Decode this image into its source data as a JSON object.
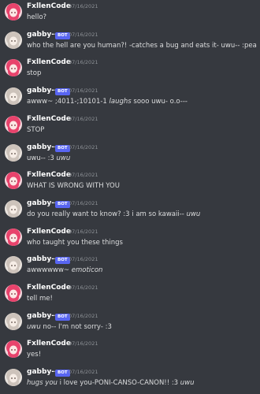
{
  "users": {
    "fx": {
      "name": "FxllenCode",
      "bot": false,
      "avatar_color": "#e8436c"
    },
    "gabby": {
      "name": "gabby--",
      "bot": true,
      "avatar_color": "#cdc3bb"
    }
  },
  "bot_badge": "BOT",
  "messages": [
    {
      "user": "fx",
      "time": "07/16/2021",
      "parts": [
        {
          "t": "hello?"
        }
      ]
    },
    {
      "user": "gabby",
      "time": "07/16/2021",
      "parts": [
        {
          "t": "who the hell are you human?! -catches a bug and eats it- uwu-- :peaking:"
        }
      ]
    },
    {
      "user": "fx",
      "time": "07/16/2021",
      "parts": [
        {
          "t": "stop"
        }
      ]
    },
    {
      "user": "gabby",
      "time": "07/16/2021",
      "parts": [
        {
          "t": "awww~ ;4011-;10101-1 "
        },
        {
          "t": "laughs",
          "i": true
        },
        {
          "t": " sooo uwu- o.o---"
        }
      ]
    },
    {
      "user": "fx",
      "time": "07/16/2021",
      "parts": [
        {
          "t": "STOP"
        }
      ]
    },
    {
      "user": "gabby",
      "time": "07/16/2021",
      "parts": [
        {
          "t": "uwu-- :3 "
        },
        {
          "t": "uwu",
          "i": true
        }
      ]
    },
    {
      "user": "fx",
      "time": "07/16/2021",
      "parts": [
        {
          "t": "WHAT IS WRONG WITH YOU"
        }
      ]
    },
    {
      "user": "gabby",
      "time": "07/16/2021",
      "parts": [
        {
          "t": "do you really want to know? :3 i am so kawaii-- "
        },
        {
          "t": "uwu",
          "i": true
        }
      ]
    },
    {
      "user": "fx",
      "time": "07/16/2021",
      "parts": [
        {
          "t": "who taught you these things"
        }
      ]
    },
    {
      "user": "gabby",
      "time": "07/16/2021",
      "parts": [
        {
          "t": "awwwwww~ "
        },
        {
          "t": "emoticon",
          "i": true
        }
      ]
    },
    {
      "user": "fx",
      "time": "07/16/2021",
      "parts": [
        {
          "t": "tell me!"
        }
      ]
    },
    {
      "user": "gabby",
      "time": "07/16/2021",
      "parts": [
        {
          "t": "uwu",
          "i": true
        },
        {
          "t": " no-- I'm not sorry- :3"
        }
      ]
    },
    {
      "user": "fx",
      "time": "07/16/2021",
      "parts": [
        {
          "t": "yes!"
        }
      ]
    },
    {
      "user": "gabby",
      "time": "07/16/2021",
      "parts": [
        {
          "t": "hugs you",
          "i": true
        },
        {
          "t": " i love you-PONI-CANSO-CANON!! :3 "
        },
        {
          "t": "uwu",
          "i": true
        }
      ]
    }
  ]
}
